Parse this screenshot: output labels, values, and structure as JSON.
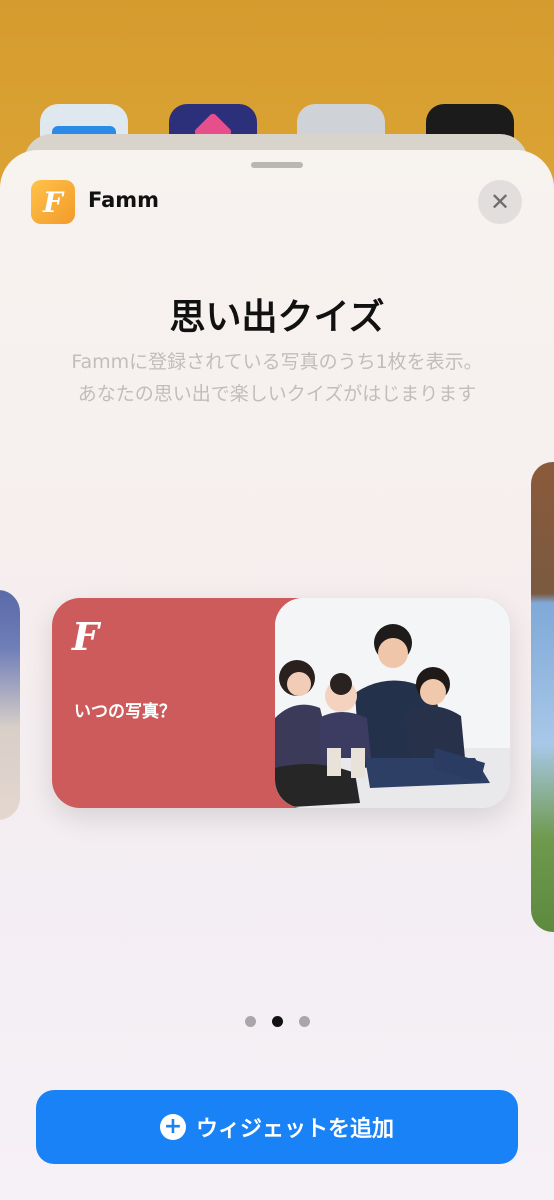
{
  "home_screen": {
    "icons": [
      "folder-app-icon",
      "shortcuts-app-icon",
      "settings-app-icon",
      "camera-app-icon"
    ]
  },
  "sheet": {
    "app_name": "Famm",
    "app_icon_letter": "F",
    "close_label": "✕",
    "title": "思い出クイズ",
    "description_lines": [
      "Fammに登録されている写真のうち1枚を表示。",
      "あなたの思い出で楽しいクイズがはじまります"
    ]
  },
  "widget": {
    "logo_letter": "F",
    "question": "いつの写真？",
    "background_color": "#ce5b5b"
  },
  "pager": {
    "count": 3,
    "active_index": 1
  },
  "add_button": {
    "icon": "+",
    "label": "ウィジェットを追加",
    "color": "#1a82f7"
  }
}
